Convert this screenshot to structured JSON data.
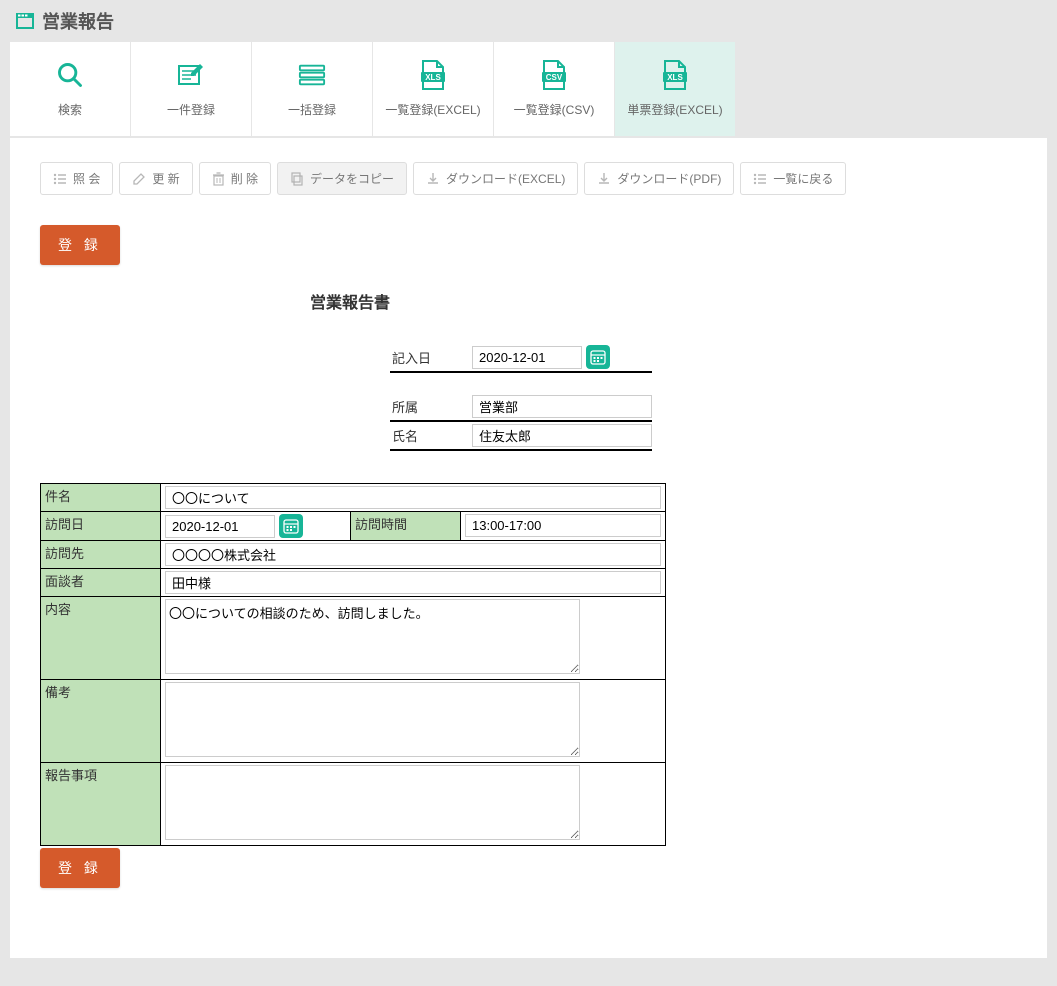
{
  "page_title": "営業報告",
  "tabs": {
    "search": "検索",
    "single": "一件登録",
    "bulk": "一括登録",
    "list_excel": "一覧登録(EXCEL)",
    "list_csv": "一覧登録(CSV)",
    "form_excel": "単票登録(EXCEL)"
  },
  "toolbar": {
    "inquiry": "照 会",
    "update": "更 新",
    "delete": "削 除",
    "copy": "データをコピー",
    "dl_excel": "ダウンロード(EXCEL)",
    "dl_pdf": "ダウンロード(PDF)",
    "back": "一覧に戻る"
  },
  "register_label": "登 録",
  "form": {
    "title": "営業報告書",
    "entry_date_label": "記入日",
    "entry_date": "2020-12-01",
    "dept_label": "所属",
    "dept": "営業部",
    "name_label": "氏名",
    "name": "住友太郎",
    "subject_label": "件名",
    "subject": "〇〇について",
    "visit_date_label": "訪問日",
    "visit_date": "2020-12-01",
    "visit_time_label": "訪問時間",
    "visit_time": "13:00-17:00",
    "visit_to_label": "訪問先",
    "visit_to": "〇〇〇〇株式会社",
    "interviewee_label": "面談者",
    "interviewee": "田中様",
    "content_label": "内容",
    "content": "〇〇についての相談のため、訪問しました。",
    "remarks_label": "備考",
    "remarks": "",
    "report_label": "報告事項",
    "report": ""
  }
}
